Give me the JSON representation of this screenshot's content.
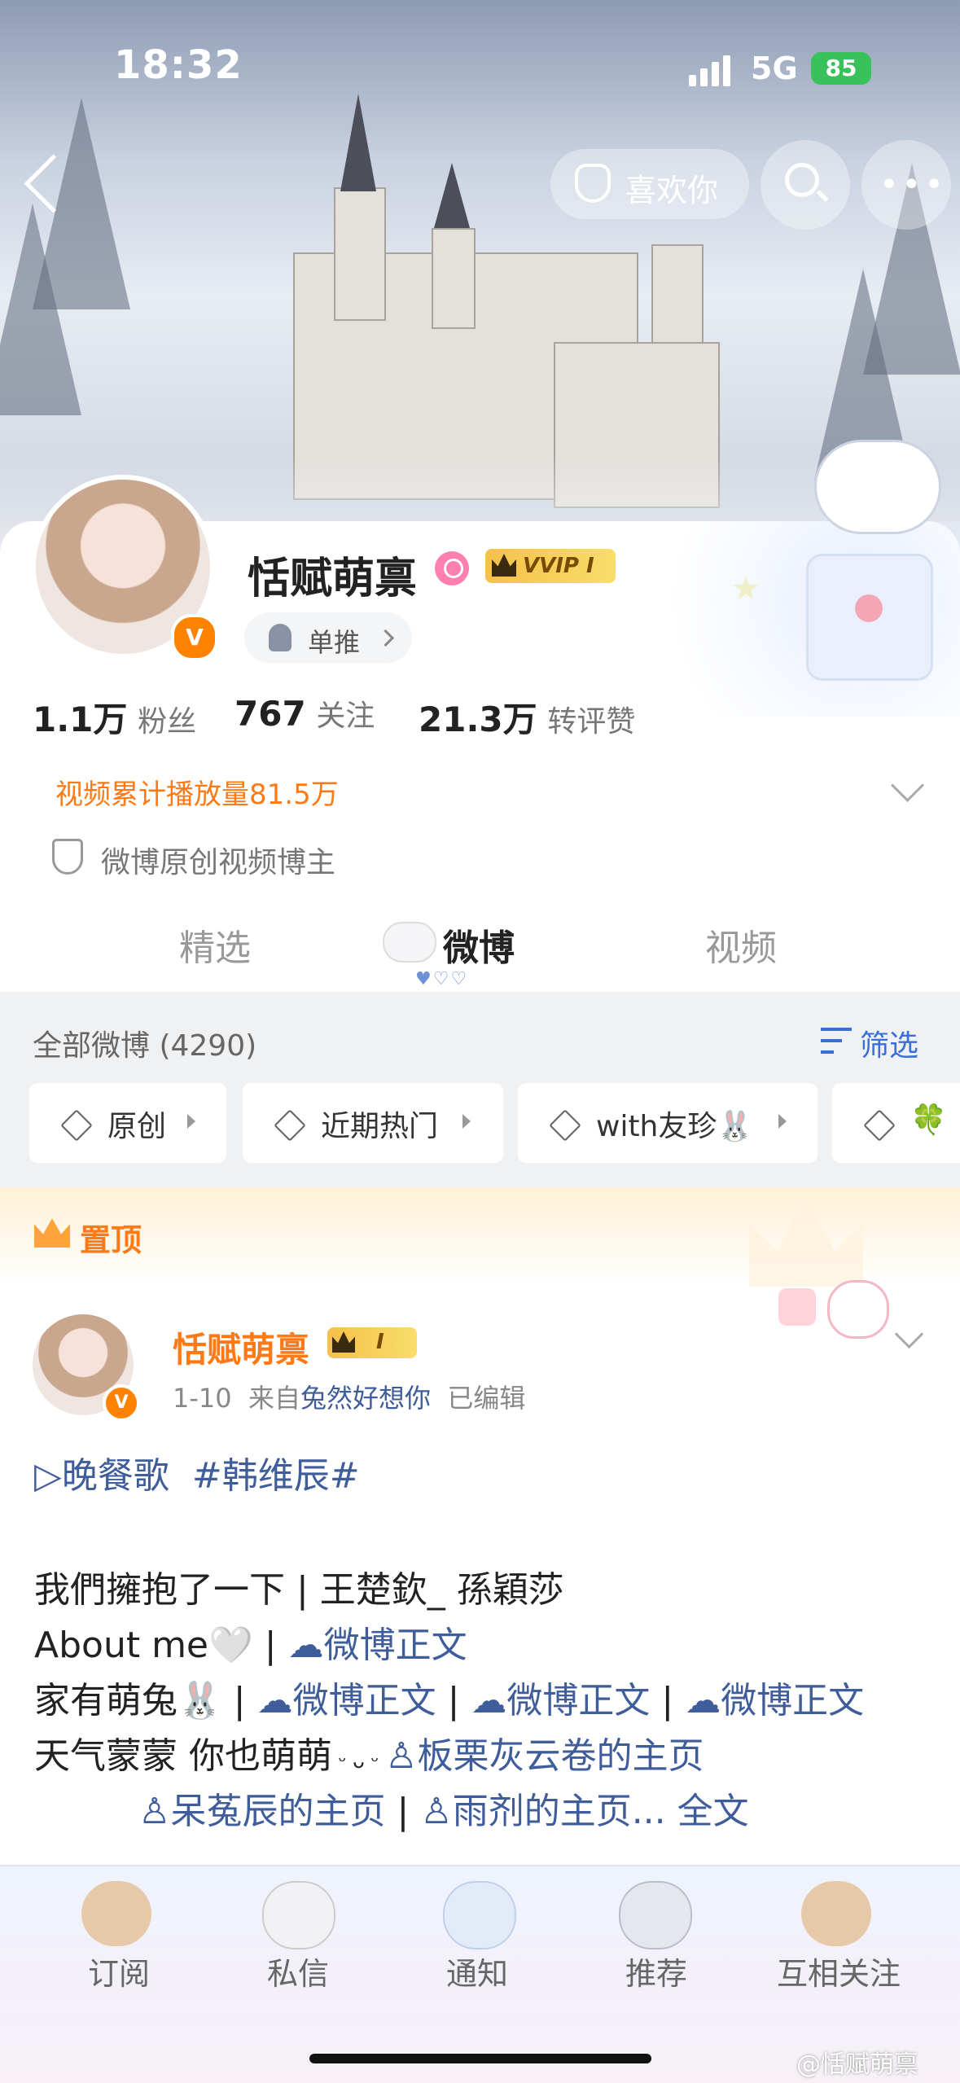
{
  "status_bar": {
    "time": "18:32",
    "network": "5G",
    "battery": "85"
  },
  "header": {
    "like_label": "喜欢你"
  },
  "profile": {
    "name": "恬赋萌禀",
    "verified_badge": "V",
    "vip_label": "VVIP I",
    "fan_tag": "单推",
    "stats": [
      {
        "value": "1.1万",
        "label": "粉丝"
      },
      {
        "value": "767",
        "label": "关注"
      },
      {
        "value": "21.3万",
        "label": "转评赞"
      }
    ],
    "video_plays": "视频累计播放量81.5万",
    "certification": "微博原创视频博主"
  },
  "tabs": {
    "items": [
      "精选",
      "微博",
      "视频"
    ],
    "active": "微博"
  },
  "feed": {
    "title": "全部微博 (4290)",
    "filter_label": "筛选",
    "chips": [
      "原创",
      "近期热门",
      "with友珍🐰",
      "🍀"
    ]
  },
  "pinned": {
    "label": "置顶",
    "author": "恬赋萌禀",
    "author_badge": "I",
    "date": "1-10",
    "from_prefix": "来自",
    "source": "兔然好想你",
    "edited": "已编辑",
    "lines": {
      "tags_a": "▷晚餐歌",
      "tags_b": "#韩维辰#",
      "l1": "我們擁抱了一下 | 王楚欽_ 孫穎莎",
      "l2_a": "About me🤍 | ",
      "l2_link": "☁微博正文",
      "l3_a": "家有萌兔🐰 | ",
      "l3_link1": "☁微博正文",
      "l3_sep1": " | ",
      "l3_link2": "☁微博正文",
      "l3_sep2": " | ",
      "l3_link3": "☁微博正文",
      "l4_a": "天气蒙蒙 你也萌萌",
      "l4_small": " ᵕ ᴗ ᵕ ",
      "l4_link": "♙板栗灰云卷的主页",
      "l5_link1": "♙呆菟辰的主页",
      "l5_sep": " | ",
      "l5_link2": "♙雨剂的主页...",
      "l5_more": " 全文"
    }
  },
  "bottom_nav": [
    "订阅",
    "私信",
    "通知",
    "推荐",
    "互相关注"
  ],
  "watermark": "@恬赋萌禀",
  "colors": {
    "accent": "#ff7a17",
    "link": "#3f5d9a",
    "filter_blue": "#3a6fd8"
  }
}
